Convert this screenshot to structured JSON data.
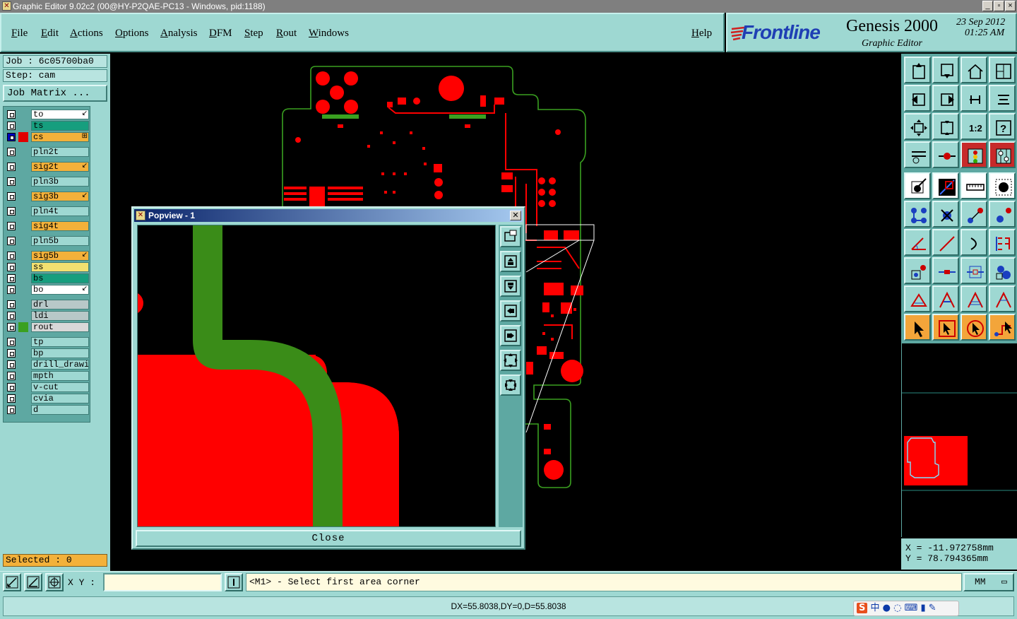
{
  "window": {
    "title": "Graphic Editor 9.02c2 (00@HY-P2QAE-PC13 - Windows, pid:1188)",
    "controls": [
      "_",
      "▫",
      "×"
    ]
  },
  "menu": {
    "items": [
      "File",
      "Edit",
      "Actions",
      "Options",
      "Analysis",
      "DFM",
      "Step",
      "Rout",
      "Windows"
    ],
    "help": "Help"
  },
  "brand": {
    "logo": "Frontline",
    "product": "Genesis 2000",
    "date": "23  Sep  2012",
    "time": "01:25  AM",
    "subtitle": "Graphic Editor"
  },
  "job": {
    "job_label": "Job : 6c05700ba0",
    "step_label": "Step: cam",
    "matrix_button": "Job Matrix ..."
  },
  "layers": [
    {
      "name": "to",
      "bg": "#ffffff",
      "swatch": "",
      "mark": "↙"
    },
    {
      "name": "ts",
      "bg": "#169e7e",
      "swatch": "",
      "mark": ""
    },
    {
      "name": "cs",
      "bg": "#f3b13a",
      "swatch": "#e00000",
      "mark": "⊞",
      "active": true
    },
    {
      "name": "pln2t",
      "bg": "#9ed8d2",
      "swatch": "",
      "mark": ""
    },
    {
      "name": "sig2t",
      "bg": "#f3b13a",
      "swatch": "",
      "mark": "↙"
    },
    {
      "name": "pln3b",
      "bg": "#9ed8d2",
      "swatch": "",
      "mark": ""
    },
    {
      "name": "sig3b",
      "bg": "#f3b13a",
      "swatch": "",
      "mark": "↙"
    },
    {
      "name": "pln4t",
      "bg": "#9ed8d2",
      "swatch": "",
      "mark": ""
    },
    {
      "name": "sig4t",
      "bg": "#f3b13a",
      "swatch": "",
      "mark": ""
    },
    {
      "name": "pln5b",
      "bg": "#9ed8d2",
      "swatch": "",
      "mark": ""
    },
    {
      "name": "sig5b",
      "bg": "#f3b13a",
      "swatch": "",
      "mark": "↙"
    },
    {
      "name": "ss",
      "bg": "#f3e070",
      "swatch": "",
      "mark": ""
    },
    {
      "name": "bs",
      "bg": "#169e7e",
      "swatch": "",
      "mark": ""
    },
    {
      "name": "bo",
      "bg": "#ffffff",
      "swatch": "",
      "mark": "↙"
    },
    {
      "name": "drl",
      "bg": "#b8c8c8",
      "swatch": "",
      "mark": ""
    },
    {
      "name": "ldi",
      "bg": "#b8c8c8",
      "swatch": "",
      "mark": ""
    },
    {
      "name": "rout",
      "bg": "#d8d8d8",
      "swatch": "#3aa020",
      "mark": ""
    },
    {
      "name": "tp",
      "bg": "#9ed8d2",
      "swatch": "",
      "mark": ""
    },
    {
      "name": "bp",
      "bg": "#9ed8d2",
      "swatch": "",
      "mark": ""
    },
    {
      "name": "drill_drawing",
      "bg": "#9ed8d2",
      "swatch": "",
      "mark": ""
    },
    {
      "name": "mpth",
      "bg": "#9ed8d2",
      "swatch": "",
      "mark": ""
    },
    {
      "name": "v-cut",
      "bg": "#9ed8d2",
      "swatch": "",
      "mark": ""
    },
    {
      "name": "cvia",
      "bg": "#9ed8d2",
      "swatch": "",
      "mark": ""
    },
    {
      "name": "d",
      "bg": "#9ed8d2",
      "swatch": "",
      "mark": ""
    }
  ],
  "selected": "Selected : 0",
  "popview": {
    "title": "Popview - 1",
    "close_button": "Close"
  },
  "coords": {
    "x": "X  = -11.972758mm",
    "y": "Y  = 78.794365mm"
  },
  "bottom": {
    "xy_label": "X Y :",
    "xy_value": "",
    "prompt": "<M1> - Select first area corner",
    "units": "MM"
  },
  "status": "DX=55.8038,DY=0,D=55.8038",
  "ime": "中 ● ◌ ⌨ ▮ ✎",
  "colors": {
    "panel": "#9ed8d2",
    "copper": "#ff0000",
    "outline": "#3aa020"
  }
}
